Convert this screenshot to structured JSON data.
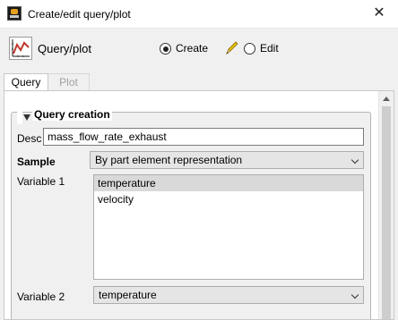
{
  "window": {
    "title": "Create/edit query/plot",
    "close_glyph": "✕"
  },
  "header": {
    "title": "Query/plot",
    "icon": "plot-chart-icon",
    "mode": {
      "create_label": "Create",
      "edit_label": "Edit",
      "selected": "Create"
    }
  },
  "tabs": [
    {
      "label": "Query",
      "active": true
    },
    {
      "label": "Plot",
      "active": false
    }
  ],
  "query_creation": {
    "title": "Query creation",
    "desc": {
      "label": "Desc",
      "value": "mass_flow_rate_exhaust"
    },
    "sample": {
      "label": "Sample",
      "value": "By part element representation"
    },
    "variable1": {
      "label": "Variable 1",
      "items": [
        "temperature",
        "velocity"
      ],
      "selected": "temperature"
    },
    "variable2": {
      "label": "Variable 2",
      "value": "temperature"
    }
  },
  "colors": {
    "accent_red": "#c0392b",
    "pencil_yellow": "#e6c200"
  }
}
